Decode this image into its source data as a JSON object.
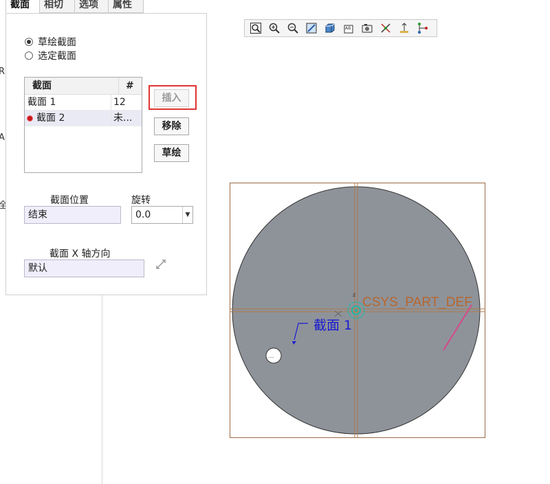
{
  "tabs": [
    {
      "label": "截面",
      "active": true
    },
    {
      "label": "相切"
    },
    {
      "label": "选项"
    },
    {
      "label": "属性"
    }
  ],
  "edge_chars": [
    "R",
    "A",
    "全"
  ],
  "sketch_mode": {
    "options": [
      {
        "label": "草绘截面",
        "selected": true
      },
      {
        "label": "选定截面",
        "selected": false
      }
    ]
  },
  "section_list": {
    "headers": [
      "截面",
      "#"
    ],
    "rows": [
      {
        "name": "截面 1",
        "count": "12",
        "selected": false,
        "marker": false
      },
      {
        "name": "截面 2",
        "count": "未...",
        "selected": true,
        "marker": true
      }
    ]
  },
  "buttons": {
    "insert": "插入",
    "remove": "移除",
    "sketch": "草绘"
  },
  "position": {
    "label": "截面位置",
    "value": "结束"
  },
  "rotate": {
    "label": "旋转",
    "value": "0.0"
  },
  "x_axis": {
    "label": "截面 X 轴方向",
    "value": "默认"
  },
  "toolbar": {
    "icons": [
      "zoom-fit-icon",
      "zoom-in-icon",
      "zoom-out-icon",
      "repaint-icon",
      "display-style-icon",
      "saved-views-icon",
      "view-manager-icon",
      "datum-display-icon",
      "annotation-display-icon",
      "spin-center-icon"
    ]
  },
  "canvas": {
    "csys_label": "CSYS_PART_DEF",
    "section_label": "截面 1",
    "colors": {
      "disc": "#8e939a",
      "frame": "#9a6a44",
      "csys_text": "#b8662c",
      "section_text": "#1a1ad0",
      "csys_marker": "#22b7a6",
      "pink_line": "#d6488a"
    }
  }
}
